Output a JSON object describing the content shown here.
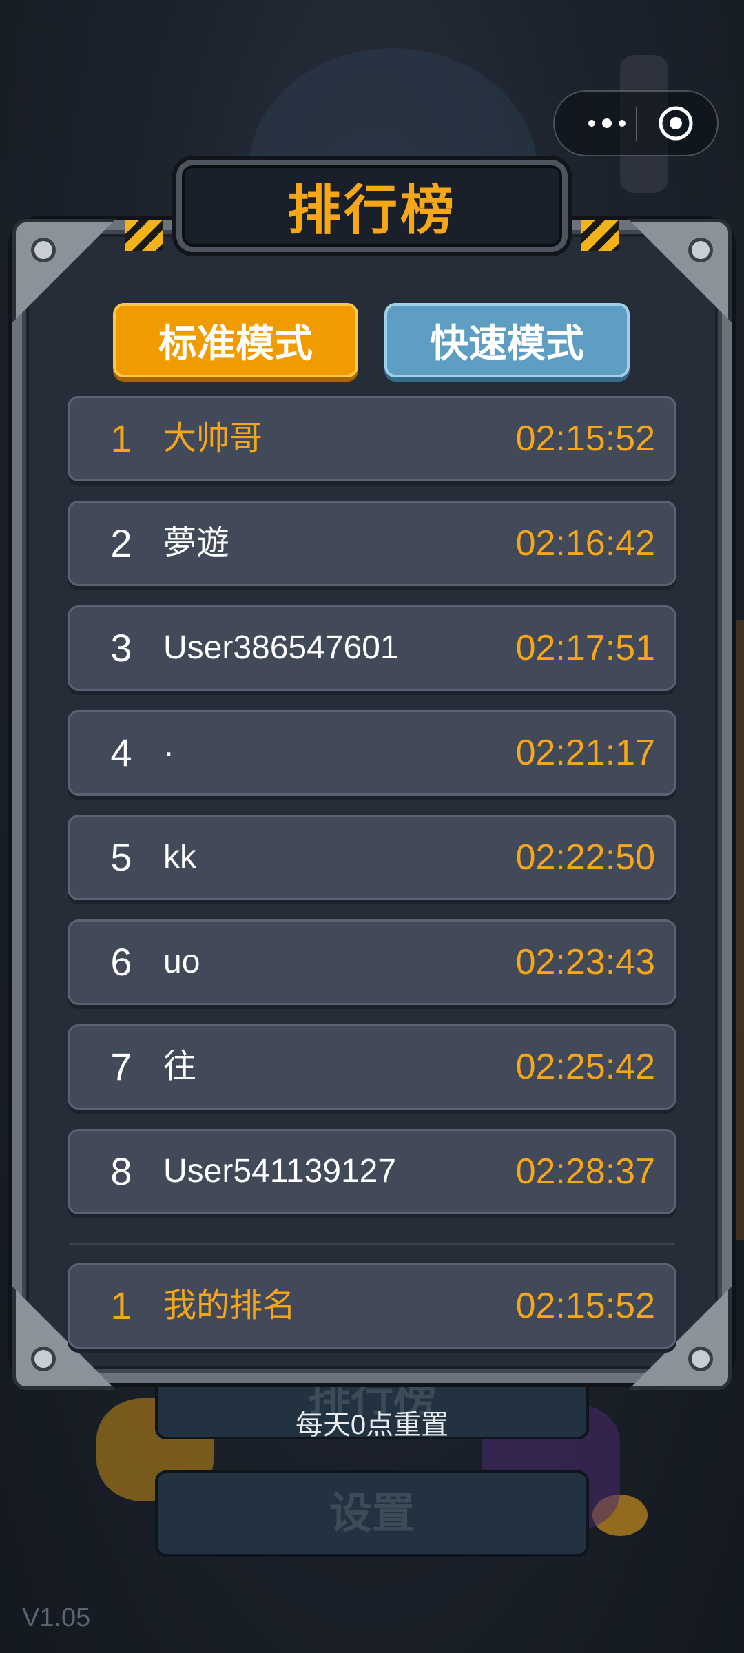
{
  "app": {
    "title": "排行榜",
    "version": "V1.05"
  },
  "tabs": [
    {
      "label": "标准模式",
      "active": true
    },
    {
      "label": "快速模式",
      "active": false
    }
  ],
  "leaderboard": [
    {
      "rank": "1",
      "name": "大帅哥",
      "time": "02:15:52"
    },
    {
      "rank": "2",
      "name": "夢遊",
      "time": "02:16:42"
    },
    {
      "rank": "3",
      "name": "User386547601",
      "time": "02:17:51"
    },
    {
      "rank": "4",
      "name": "·",
      "time": "02:21:17"
    },
    {
      "rank": "5",
      "name": "kk",
      "time": "02:22:50"
    },
    {
      "rank": "6",
      "name": "uo",
      "time": "02:23:43"
    },
    {
      "rank": "7",
      "name": "往",
      "time": "02:25:42"
    },
    {
      "rank": "8",
      "name": "User541139127",
      "time": "02:28:37"
    }
  ],
  "my_rank": {
    "rank": "1",
    "name": "我的排名",
    "time": "02:15:52"
  },
  "background_buttons": {
    "leaderboard": "排行榜",
    "settings": "设置"
  },
  "reset_note": "每天0点重置",
  "icons": {
    "more": "more-dots-icon",
    "close": "target-close-icon"
  },
  "colors": {
    "accent": "#f6a619",
    "tab_active": "#f09c00",
    "tab_inactive": "#5e9ec2",
    "row_bg": "#424a5a"
  }
}
